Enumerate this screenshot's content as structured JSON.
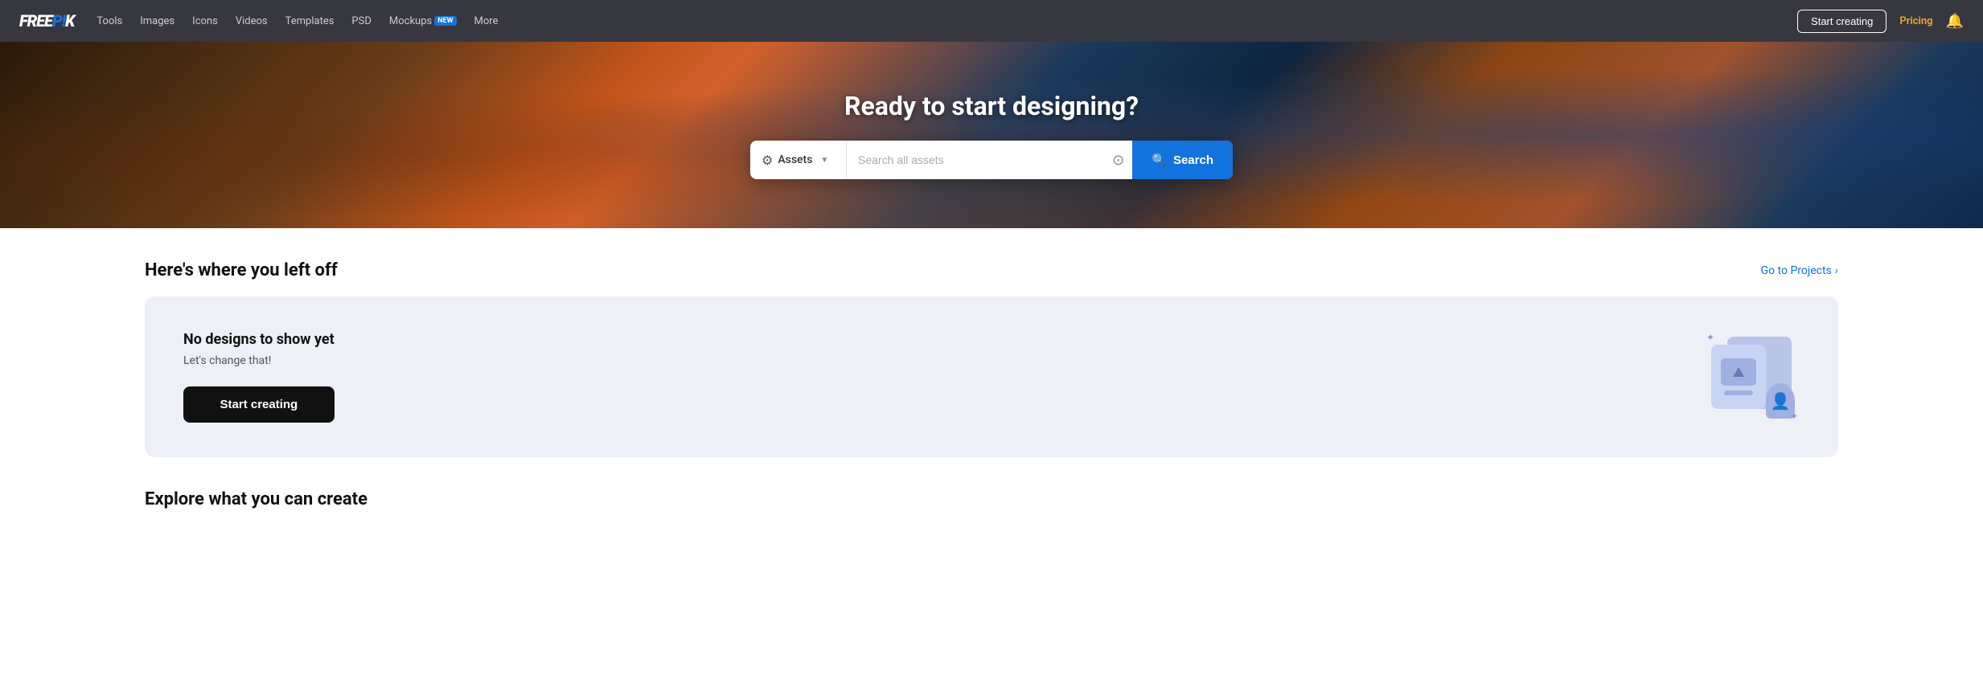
{
  "logo": {
    "text_free": "FREE",
    "text_pik": "P!K"
  },
  "nav": {
    "links": [
      {
        "label": "Tools",
        "badge": null
      },
      {
        "label": "Images",
        "badge": null
      },
      {
        "label": "Icons",
        "badge": null
      },
      {
        "label": "Videos",
        "badge": null
      },
      {
        "label": "Templates",
        "badge": null
      },
      {
        "label": "PSD",
        "badge": null
      },
      {
        "label": "Mockups",
        "badge": "NEW"
      },
      {
        "label": "More",
        "badge": null
      }
    ],
    "start_creating": "Start creating",
    "pricing": "Pricing"
  },
  "hero": {
    "title": "Ready to start designing?",
    "search": {
      "category": "Assets",
      "placeholder": "Search all assets",
      "button_label": "Search"
    }
  },
  "projects": {
    "section_title": "Here's where you left off",
    "go_to_projects": "Go to Projects",
    "empty_title": "No designs to show yet",
    "empty_subtitle": "Let's change that!",
    "start_creating": "Start creating"
  },
  "bottom": {
    "section_title": "Explore what you can create"
  }
}
